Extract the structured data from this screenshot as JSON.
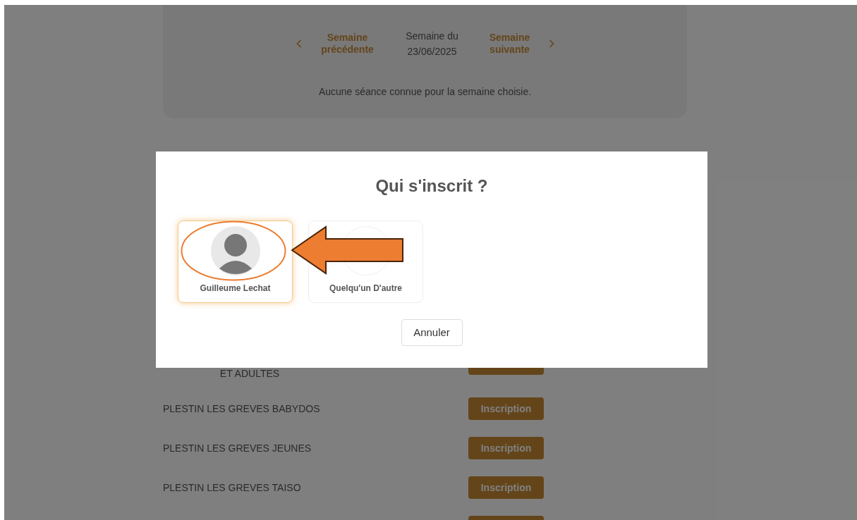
{
  "week_nav": {
    "previous": "Semaine précédente",
    "current": "Semaine du 23/06/2025",
    "next": "Semaine suivante"
  },
  "sessions_message": "Aucune séance connue pour la semaine choisie.",
  "categories": [
    {
      "kind": "continued",
      "name": "ET ADULTES"
    },
    {
      "kind": "row",
      "name": "PLESTIN LES GREVES BABYDOS",
      "button": "Inscription"
    },
    {
      "kind": "row",
      "name": "PLESTIN LES GREVES JEUNES",
      "button": "Inscription"
    },
    {
      "kind": "row",
      "name": "PLESTIN LES GREVES TAISO",
      "button": "Inscription"
    },
    {
      "kind": "cut"
    }
  ],
  "dialog": {
    "title": "Qui s'inscrit ?",
    "profiles": [
      {
        "kind": "user",
        "name": "Guilleume Lechat",
        "selected": true
      },
      {
        "kind": "other",
        "name": "Quelqu'un D'autre",
        "selected": false
      }
    ],
    "cancel": "Annuler"
  }
}
